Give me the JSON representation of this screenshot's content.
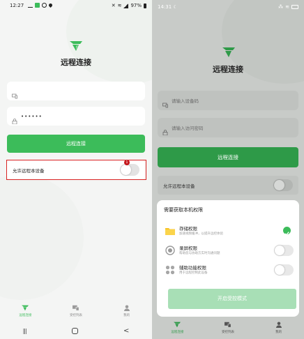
{
  "left": {
    "status": {
      "time": "12:27",
      "battery": "97%"
    },
    "app_title": "远程连接",
    "device_field": {
      "value": ""
    },
    "password_field": {
      "value": "••••••"
    },
    "connect_button": "远程连接",
    "allow_row": {
      "label": "允许远程本设备",
      "badge": "1"
    },
    "tabs": [
      {
        "label": "远程连接",
        "icon": "logo-icon",
        "active": true
      },
      {
        "label": "受控列表",
        "icon": "devices-icon",
        "active": false
      },
      {
        "label": "我的",
        "icon": "user-icon",
        "active": false
      }
    ],
    "nav": {
      "recent": "|||",
      "home": "O",
      "back": "<"
    }
  },
  "right": {
    "status": {
      "time": "14:31"
    },
    "app_title": "远程连接",
    "device_field": {
      "placeholder": "请输入设备码"
    },
    "password_field": {
      "placeholder": "请输入访问密码"
    },
    "connect_button": "远程连接",
    "allow_row": {
      "label": "允许远程本设备"
    },
    "sheet": {
      "title": "需要获取本机权限",
      "permissions": [
        {
          "name": "存储权限",
          "desc": "加速视频缓冲，以提升远控体验",
          "granted": true,
          "icon": "folder-icon"
        },
        {
          "name": "录屏权限",
          "desc": "帮助您与协助方实时沟通问题",
          "granted": false,
          "icon": "record-icon"
        },
        {
          "name": "辅助功能权限",
          "desc": "用于远程控制此设备",
          "granted": false,
          "icon": "apps-icon"
        }
      ],
      "start_button": "开启受控模式"
    },
    "tabs": [
      {
        "label": "远程连接",
        "active": true
      },
      {
        "label": "受控列表",
        "active": false
      },
      {
        "label": "我的",
        "active": false
      }
    ]
  },
  "colors": {
    "accent": "#3cbc5a",
    "highlight": "#d92323"
  }
}
